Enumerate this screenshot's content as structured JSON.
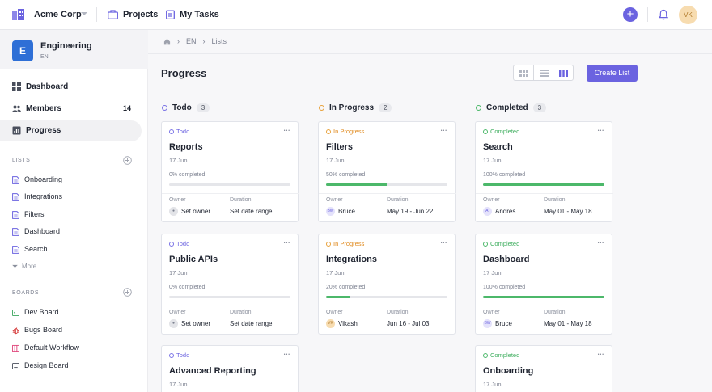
{
  "topbar": {
    "company": "Acme Corp",
    "nav": [
      "Projects",
      "My Tasks"
    ],
    "avatar": "VK",
    "accent": "#6b63e0"
  },
  "sidebar": {
    "workspace": {
      "initial": "E",
      "name": "Engineering",
      "code": "EN"
    },
    "nav": [
      {
        "label": "Dashboard",
        "icon": "dashboard-icon",
        "count": ""
      },
      {
        "label": "Members",
        "icon": "members-icon",
        "count": "14"
      },
      {
        "label": "Progress",
        "icon": "progress-icon",
        "count": "",
        "active": true
      }
    ],
    "lists_title": "LISTS",
    "lists": [
      "Onboarding",
      "Integrations",
      "Filters",
      "Dashboard",
      "Search"
    ],
    "more": "More",
    "boards_title": "BOARDS",
    "boards": [
      {
        "label": "Dev Board",
        "color": "#3aa55d",
        "icon": "dev-board-icon"
      },
      {
        "label": "Bugs Board",
        "color": "#d63b3b",
        "icon": "bug-icon"
      },
      {
        "label": "Default Workflow",
        "color": "#e0457b",
        "icon": "workflow-icon"
      },
      {
        "label": "Design Board",
        "color": "#4a4f5c",
        "icon": "design-board-icon"
      }
    ]
  },
  "breadcrumb": [
    "EN",
    "Lists"
  ],
  "page_title": "Progress",
  "create_button": "Create List",
  "labels": {
    "owner": "Owner",
    "duration": "Duration"
  },
  "columns": [
    {
      "title": "Todo",
      "count": "3",
      "color": "#7b74e6",
      "cards": [
        {
          "status": "Todo",
          "title": "Reports",
          "date": "17 Jun",
          "progress_text": "0% completed",
          "progress": 0,
          "owner": "Set owner",
          "owner_initials": "",
          "duration": "Set date range"
        },
        {
          "status": "Todo",
          "title": "Public APIs",
          "date": "17 Jun",
          "progress_text": "0% completed",
          "progress": 0,
          "owner": "Set owner",
          "owner_initials": "",
          "duration": "Set date range"
        },
        {
          "status": "Todo",
          "title": "Advanced Reporting",
          "date": "17 Jun"
        }
      ]
    },
    {
      "title": "In Progress",
      "count": "2",
      "color": "#e8a23c",
      "cards": [
        {
          "status": "In Progress",
          "title": "Filters",
          "date": "17 Jun",
          "progress_text": "50% completed",
          "progress": 0.5,
          "owner": "Bruce",
          "owner_initials": "BW",
          "duration": "May 19 - Jun 22"
        },
        {
          "status": "In Progress",
          "title": "Integrations",
          "date": "17 Jun",
          "progress_text": "20% completed",
          "progress": 0.2,
          "owner": "Vikash",
          "owner_initials": "VK",
          "duration": "Jun 16 - Jul 03"
        }
      ]
    },
    {
      "title": "Completed",
      "count": "3",
      "color": "#4cb86a",
      "cards": [
        {
          "status": "Completed",
          "title": "Search",
          "date": "17 Jun",
          "progress_text": "100% completed",
          "progress": 1,
          "owner": "Andres",
          "owner_initials": "AI",
          "duration": "May 01 - May 18"
        },
        {
          "status": "Completed",
          "title": "Dashboard",
          "date": "17 Jun",
          "progress_text": "100% completed",
          "progress": 1,
          "owner": "Bruce",
          "owner_initials": "BW",
          "duration": "May 01 - May 18"
        },
        {
          "status": "Completed",
          "title": "Onboarding",
          "date": "17 Jun"
        }
      ]
    }
  ]
}
